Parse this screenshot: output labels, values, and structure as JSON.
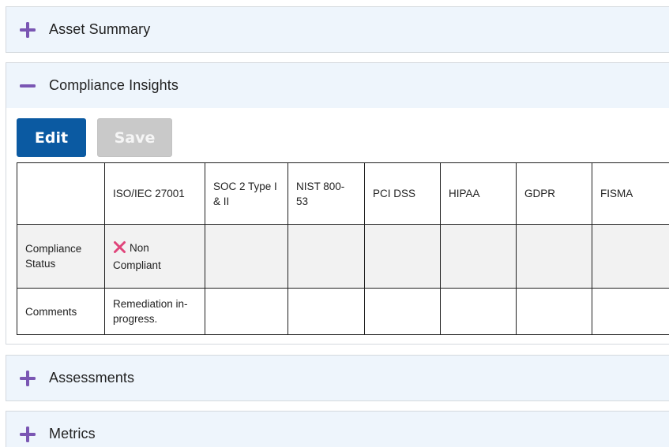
{
  "panels": {
    "asset_summary": {
      "title": "Asset Summary",
      "state": "collapsed"
    },
    "compliance_insights": {
      "title": "Compliance Insights",
      "state": "expanded"
    },
    "assessments": {
      "title": "Assessments",
      "state": "collapsed"
    },
    "metrics": {
      "title": "Metrics",
      "state": "collapsed"
    }
  },
  "toolbar": {
    "edit_label": "Edit",
    "save_label": "Save"
  },
  "table": {
    "corner": "",
    "columns": [
      "ISO/IEC 27001",
      "SOC 2 Type I & II",
      "NIST 800-53",
      "PCI DSS",
      "HIPAA",
      "GDPR",
      "FISMA"
    ],
    "rows": [
      {
        "label": "Compliance Status",
        "cells": [
          "Non Compliant",
          "",
          "",
          "",
          "",
          "",
          ""
        ]
      },
      {
        "label": "Comments",
        "cells": [
          "Remediation in-progress.",
          "",
          "",
          "",
          "",
          "",
          ""
        ]
      }
    ]
  },
  "icons": {
    "expand": "plus-icon",
    "collapse": "minus-icon",
    "status_fail": "x-mark-icon"
  },
  "colors": {
    "accent": "#7a56b3",
    "panel_header_bg": "#eef5fc",
    "edit_button": "#0b5aa2",
    "save_button_disabled": "#c9c9c9",
    "status_fail": "#e0457b",
    "status_row_bg": "#f2f2f2"
  }
}
